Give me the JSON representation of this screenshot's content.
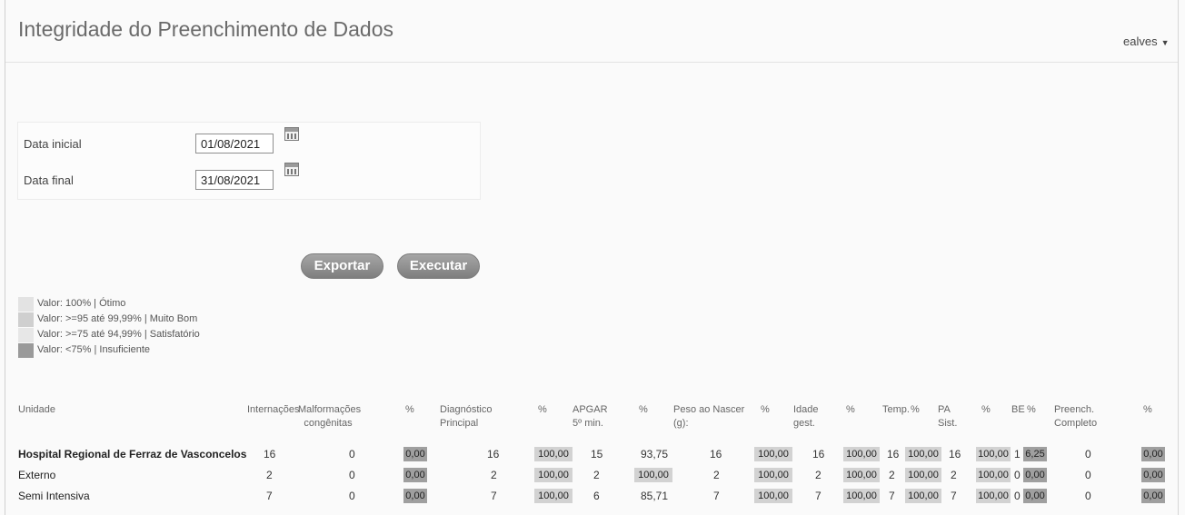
{
  "header": {
    "title": "Integridade do Preenchimento de Dados",
    "user": "ealves"
  },
  "form": {
    "start_label": "Data inicial",
    "start_value": "01/08/2021",
    "end_label": "Data final",
    "end_value": "31/08/2021"
  },
  "actions": {
    "export_label": "Exportar",
    "execute_label": "Executar"
  },
  "legend": [
    {
      "label": "Valor: 100% | Ótimo",
      "color": "#e3e3e3"
    },
    {
      "label": "Valor: >=95 até 99,99% | Muito Bom",
      "color": "#cfcfcf"
    },
    {
      "label": "Valor: >=75 até 94,99% | Satisfatório",
      "color": "#e7e7e7"
    },
    {
      "label": "Valor: <75% | Insuficiente",
      "color": "#9a9a9a"
    }
  ],
  "table": {
    "headers": {
      "unidade": "Unidade",
      "internacoes": "Internações",
      "malformacoes": "Malformações congênitas",
      "pct1": "%",
      "diagnostico": "Diagnóstico Principal",
      "pct2": "%",
      "apgar": "APGAR 5º min.",
      "pct3": "%",
      "peso": "Peso ao Nascer (g):",
      "pct4": "%",
      "idade": "Idade gest.",
      "pct5": "%",
      "temp": "Temp.",
      "pct6": "%",
      "pa": "PA Sist.",
      "pct7": "%",
      "be": "BE",
      "pct8": "%",
      "preench": "Preench. Completo",
      "pct9": "%"
    },
    "rows": [
      {
        "unidade": "Hospital Regional de Ferraz de Vasconcelos",
        "internacoes": "16",
        "malformacoes": "0",
        "p1": "0,00",
        "diagnostico": "16",
        "p2": "100,00",
        "apgar": "15",
        "p3": "93,75",
        "peso": "16",
        "p4": "100,00",
        "idade": "16",
        "p5": "100,00",
        "temp": "16",
        "p6": "100,00",
        "pa": "16",
        "p7": "100,00",
        "be": "1",
        "p8": "6,25",
        "preench": "0",
        "p9": "0,00"
      },
      {
        "unidade": "Externo",
        "internacoes": "2",
        "malformacoes": "0",
        "p1": "0,00",
        "diagnostico": "2",
        "p2": "100,00",
        "apgar": "2",
        "p3": "100,00",
        "peso": "2",
        "p4": "100,00",
        "idade": "2",
        "p5": "100,00",
        "temp": "2",
        "p6": "100,00",
        "pa": "2",
        "p7": "100,00",
        "be": "0",
        "p8": "0,00",
        "preench": "0",
        "p9": "0,00"
      },
      {
        "unidade": "Semi Intensiva",
        "internacoes": "7",
        "malformacoes": "0",
        "p1": "0,00",
        "diagnostico": "7",
        "p2": "100,00",
        "apgar": "6",
        "p3": "85,71",
        "peso": "7",
        "p4": "100,00",
        "idade": "7",
        "p5": "100,00",
        "temp": "7",
        "p6": "100,00",
        "pa": "7",
        "p7": "100,00",
        "be": "0",
        "p8": "0,00",
        "preench": "0",
        "p9": "0,00"
      }
    ]
  }
}
